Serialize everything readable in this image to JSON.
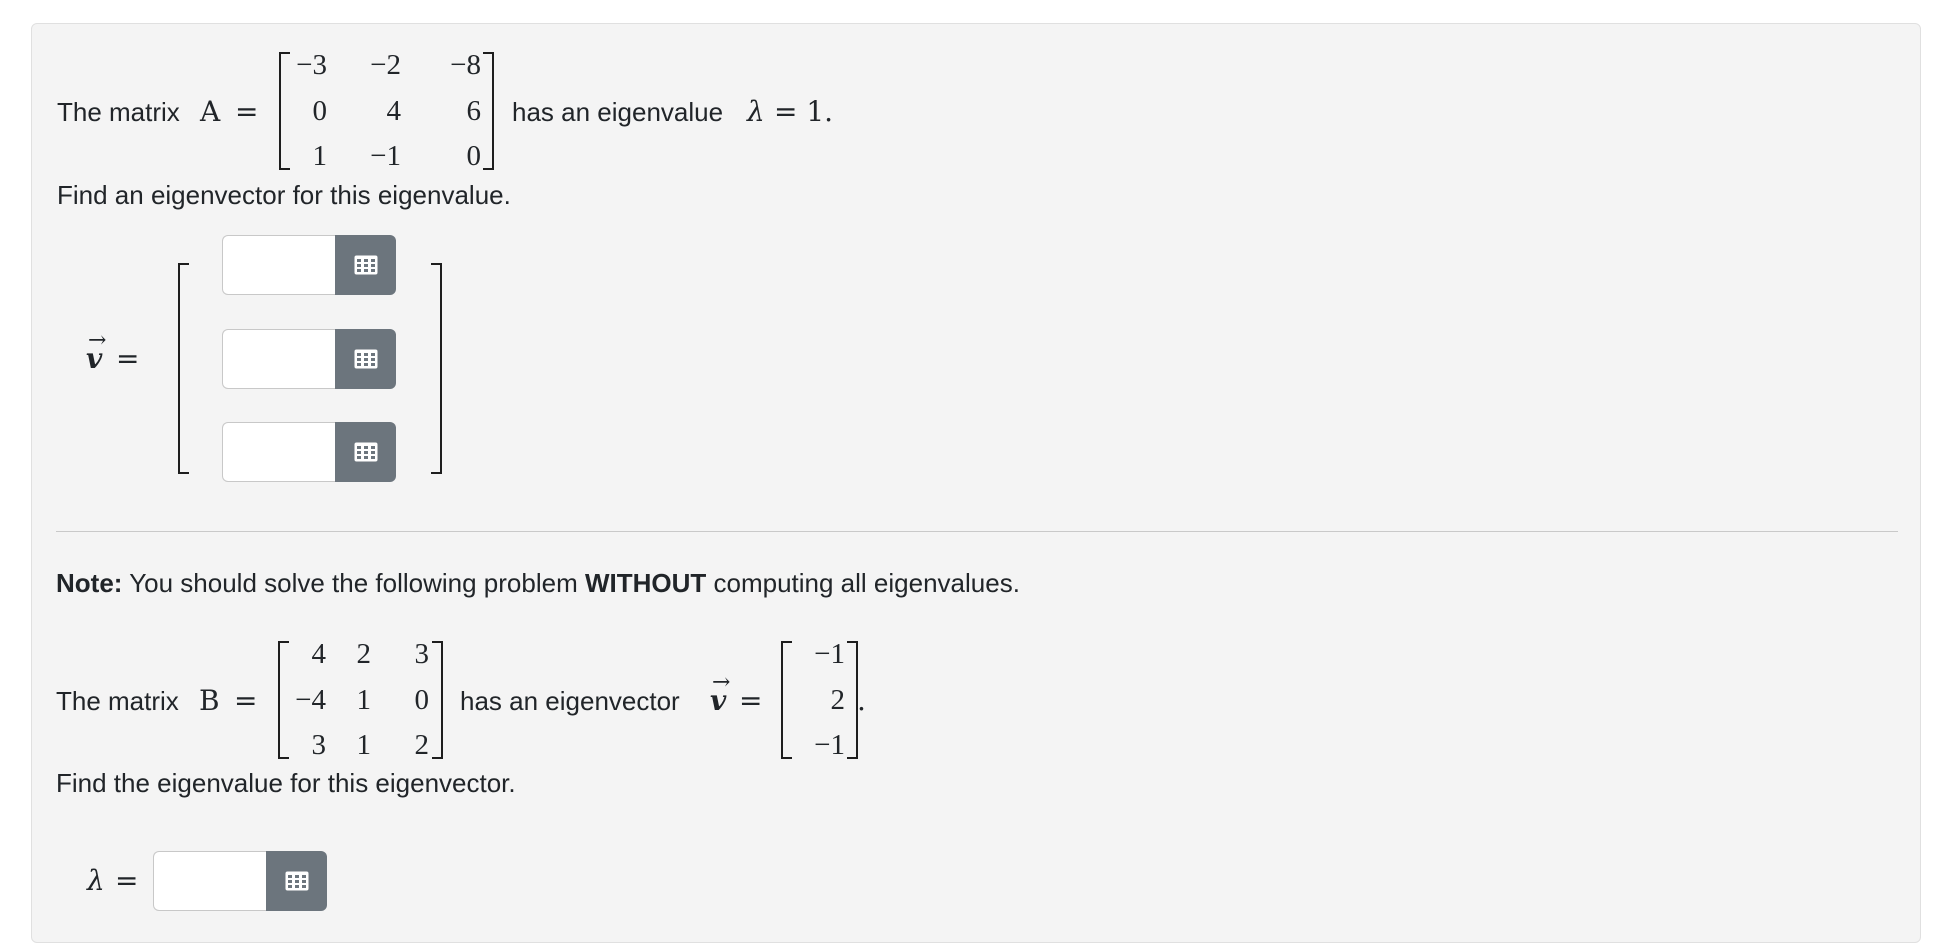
{
  "problem1": {
    "intro": "The matrix",
    "matrix_name": "A",
    "equals": "=",
    "matrix": [
      [
        "−3",
        "−2",
        "−8"
      ],
      [
        "0",
        "4",
        "6"
      ],
      [
        "1",
        "−1",
        "0"
      ]
    ],
    "after_matrix": "has an eigenvalue",
    "lambda_symbol": "λ",
    "lambda_value": "= 1.",
    "instruction": "Find an eigenvector for this eigenvalue.",
    "answer_symbol": "v",
    "answer_equals": "=",
    "inputs": [
      {
        "value": "",
        "placeholder": ""
      },
      {
        "value": "",
        "placeholder": ""
      },
      {
        "value": "",
        "placeholder": ""
      }
    ]
  },
  "problem2": {
    "note_label": "Note:",
    "note_text_1": " You should solve the following problem ",
    "note_emphasis": "WITHOUT",
    "note_text_2": " computing all eigenvalues.",
    "intro": "The matrix",
    "matrix_name": "B",
    "equals": "=",
    "matrix": [
      [
        "4",
        "2",
        "3"
      ],
      [
        "−4",
        "1",
        "0"
      ],
      [
        "3",
        "1",
        "2"
      ]
    ],
    "after_matrix": "has an eigenvector",
    "vector_symbol": "v",
    "vector_equals": "=",
    "vector": [
      "−1",
      "2",
      "−1"
    ],
    "trailing_period": ".",
    "instruction": "Find the eigenvalue for this eigenvector.",
    "answer_symbol": "λ",
    "answer_equals": "=",
    "input": {
      "value": "",
      "placeholder": ""
    }
  },
  "icons": {
    "input_button_icon": "grid-icon"
  },
  "colors": {
    "card_bg": "#f4f4f4",
    "button_bg": "#6c757d",
    "divider": "#c9c9c9"
  }
}
